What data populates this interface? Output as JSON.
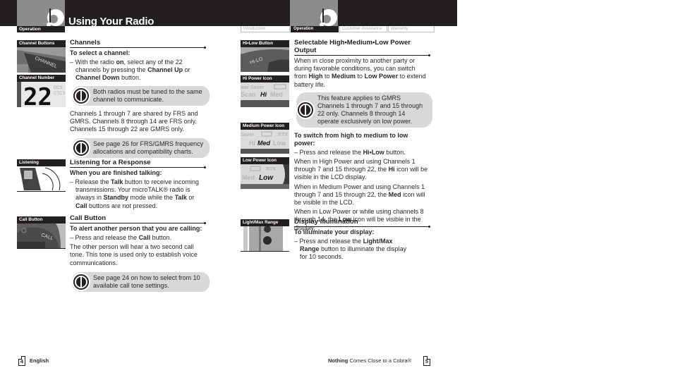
{
  "header": {
    "section_tab": "Operation",
    "page_title": "Using Your Radio",
    "nav_tabs": [
      "Introduction",
      "Operation",
      "Customer Assistance",
      "Warranty"
    ],
    "active_tab": "Operation"
  },
  "left_page": {
    "image_captions": [
      "Channel Buttons",
      "Channel Number",
      "Listening",
      "Call Button"
    ],
    "channels": {
      "title": "Channels",
      "subtitle": "To select a channel:",
      "step_prefix": "– With the radio ",
      "step_b1": "on",
      "step_mid": ", select any of the 22 channels by pressing the ",
      "step_b2": "Channel Up",
      "step_mid2": " or ",
      "step_b3": "Channel Down",
      "step_end": " button.",
      "tip1": "Both radios must be tuned to the same channel to communicate.",
      "body": "Channels 1 through 7 are shared by FRS and GMRS. Channels 8 through 14 are FRS only. Channels 15 through 22 are GMRS only.",
      "tip2": "See page 26 for FRS/GMRS frequency allocations and compatibility charts."
    },
    "listening": {
      "title": "Listening for a Response",
      "subtitle": "When you are finished talking:",
      "p1": "– Release the ",
      "b1": "Talk",
      "p2": " button to receive incoming transmissions. Your microTALK® radio is always in ",
      "b2": "Standby",
      "p3": " mode while the ",
      "b3": "Talk",
      "p4": " or ",
      "b4": "Call",
      "p5": " buttons are not pressed."
    },
    "call": {
      "title": "Call Button",
      "subtitle": "To alert another person that you are calling:",
      "step_pre": "– Press and release the ",
      "step_b": "Call",
      "step_end": " button.",
      "body": "The other person will hear a two second call tone. This tone is used only to establish voice communications.",
      "tip": "See page 24 on how to select from 10 available call tone settings."
    },
    "footer": {
      "page_number": "4",
      "language": "English"
    }
  },
  "right_page": {
    "image_captions": [
      "Hi•Low Button",
      "Hi Power Icon",
      "Medium Power Icon",
      "Low Power Icon",
      "Light/Max Range"
    ],
    "power": {
      "title": "Selectable High•Medium•Low Power Output",
      "i1": "When in close proximity to another party or during favorable conditions, you can switch from ",
      "b1": "High",
      "i2": " to ",
      "b2": "Medium",
      "i3": " to ",
      "b3": "Low Power",
      "i4": " to extend battery life.",
      "tip": "This feature applies to GMRS Channels 1 through 7 and 15 through 22 only. Channels 8 through 14 operate exclusively on low power.",
      "subtitle": "To switch from high to medium to low power:",
      "step_pre": "– Press and release the ",
      "step_b": "Hi•Low",
      "step_end": " button.",
      "hi_pre": "When in High Power and using Channels 1 through 7 and 15 through 22, the ",
      "hi_b": "Hi",
      "hi_end": " icon will be visible in the LCD display.",
      "med_pre": "When in Medium Power and using Channels 1 through 7 and 15 through 22, the ",
      "med_b": "Med",
      "med_end": " icon will be visible in the LCD.",
      "low_pre": "When in Low Power or while using channels 8 through 14, the ",
      "low_b": "Low",
      "low_end": " icon will be visible in the display."
    },
    "illumination": {
      "title": "Display Illumination",
      "subtitle": "To illuminate your display:",
      "step_pre": "– Press and release the ",
      "step_b": "Light/Max Range",
      "step_end": " button to illuminate the display for 10 seconds."
    },
    "footer": {
      "brand_bold": "Nothing",
      "tagline": " Comes Close to a Cobra®",
      "page_number": "5"
    }
  },
  "lcd_labels": {
    "channel_digits": "22",
    "channel_side": [
      "DCS",
      "CTCS"
    ],
    "power_saver": "wer Saver",
    "scan": "Scan",
    "hi": "Hi",
    "med": "Med",
    "low": "Low",
    "rtx": "RTX",
    "saver": "Saver",
    "hilo_button": "HI-LO",
    "call_button": "CALL",
    "channel_button": "CHANNEL"
  }
}
